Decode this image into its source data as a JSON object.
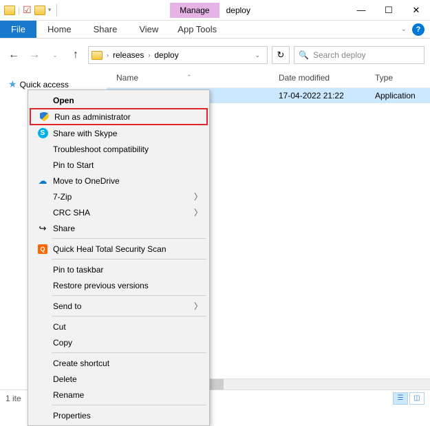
{
  "window": {
    "title": "deploy",
    "manage_tab": "Manage",
    "app_tools": "App Tools"
  },
  "ribbon": {
    "file": "File",
    "home": "Home",
    "share": "Share",
    "view": "View"
  },
  "nav": {
    "crumbs": [
      "releases",
      "deploy"
    ],
    "search_placeholder": "Search deploy"
  },
  "sidebar": {
    "quick_access": "Quick access"
  },
  "columns": {
    "name": "Name",
    "date": "Date modified",
    "type": "Type"
  },
  "row": {
    "name": "",
    "date": "17-04-2022 21:22",
    "type": "Application"
  },
  "context_menu": {
    "groups": [
      [
        {
          "label": "Open",
          "bold": true
        },
        {
          "label": "Run as administrator",
          "icon": "shield",
          "highlight": true
        },
        {
          "label": "Share with Skype",
          "icon": "skype"
        },
        {
          "label": "Troubleshoot compatibility"
        },
        {
          "label": "Pin to Start"
        },
        {
          "label": "Move to OneDrive",
          "icon": "cloud"
        },
        {
          "label": "7-Zip",
          "submenu": true
        },
        {
          "label": "CRC SHA",
          "submenu": true
        },
        {
          "label": "Share",
          "icon": "share"
        }
      ],
      [
        {
          "label": "Quick Heal Total Security Scan",
          "icon": "quickheal"
        }
      ],
      [
        {
          "label": "Pin to taskbar"
        },
        {
          "label": "Restore previous versions"
        }
      ],
      [
        {
          "label": "Send to",
          "submenu": true
        }
      ],
      [
        {
          "label": "Cut"
        },
        {
          "label": "Copy"
        }
      ],
      [
        {
          "label": "Create shortcut"
        },
        {
          "label": "Delete"
        },
        {
          "label": "Rename"
        }
      ],
      [
        {
          "label": "Properties"
        }
      ]
    ]
  },
  "status": {
    "text": "1 ite"
  }
}
